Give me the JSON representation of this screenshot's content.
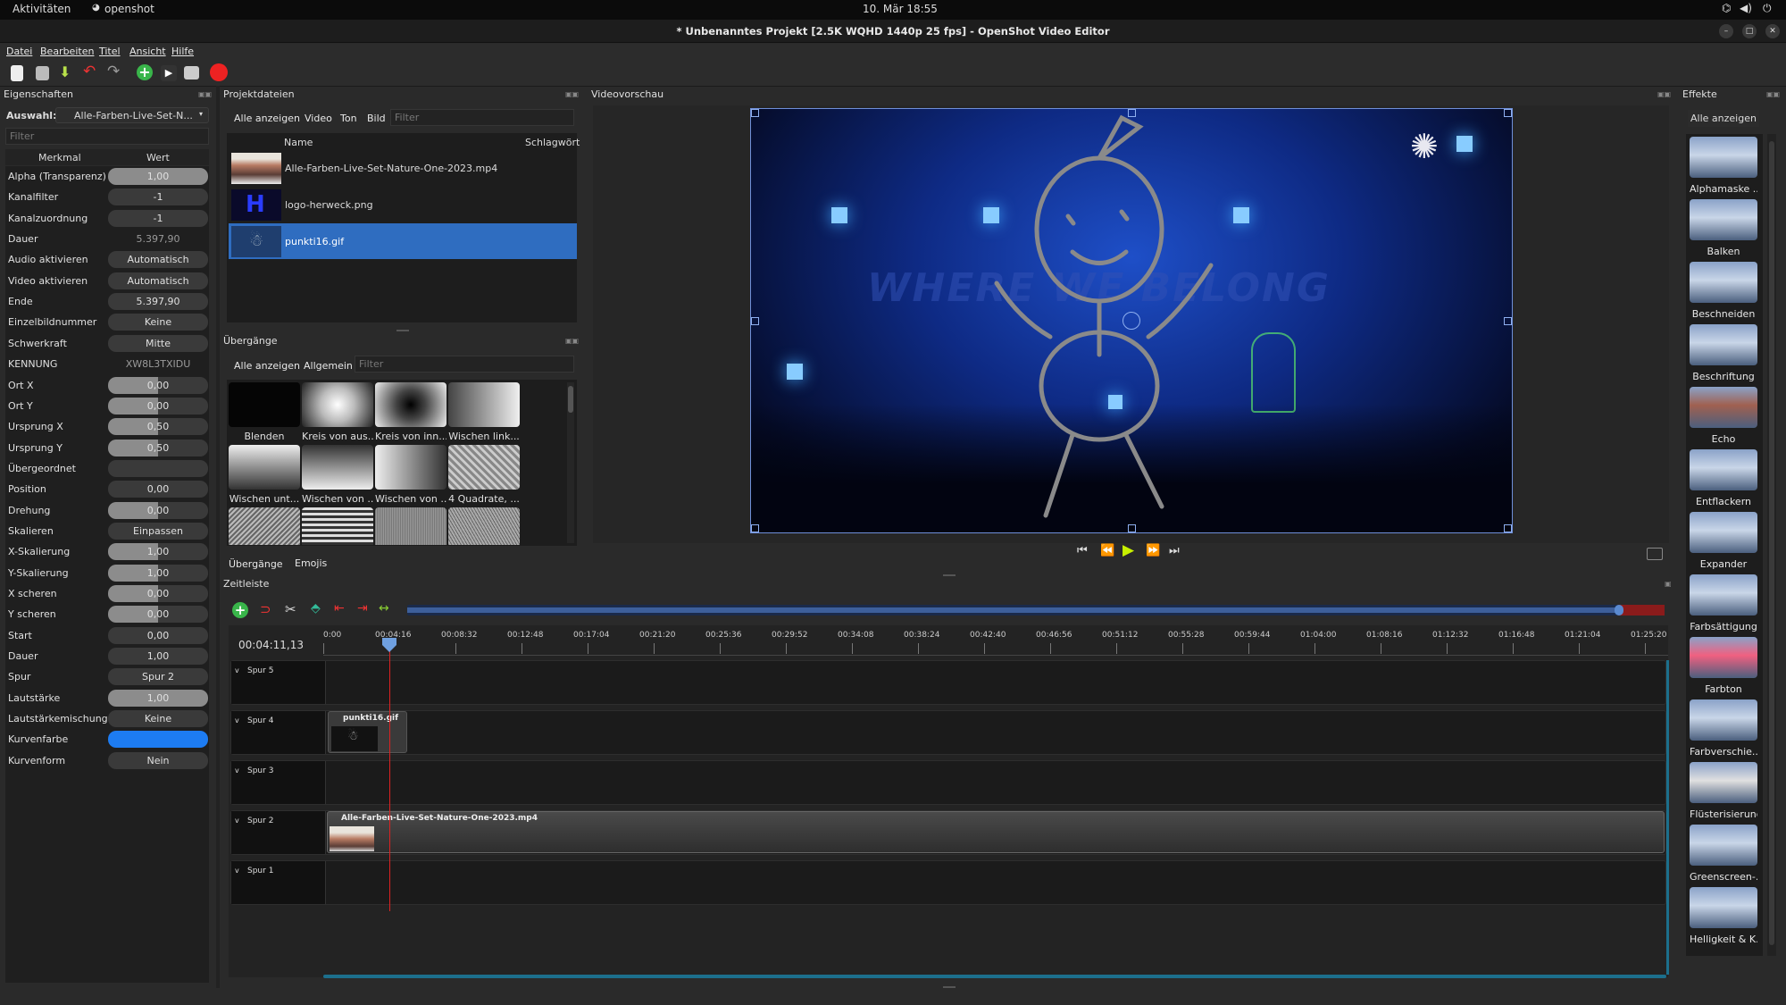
{
  "system": {
    "activities": "Aktivitäten",
    "app": "openshot",
    "clock": "10. Mär  18:55"
  },
  "window": {
    "title": "* Unbenanntes Projekt [2.5K WQHD 1440p 25 fps] - OpenShot Video Editor"
  },
  "menu": [
    "Datei",
    "Bearbeiten",
    "Titel",
    "Ansicht",
    "Hilfe"
  ],
  "properties": {
    "header": "Eigenschaften",
    "selection_label": "Auswahl:",
    "selection_value": "Alle-Farben-Live-Set-N...",
    "filter_placeholder": "Filter",
    "col_key": "Merkmal",
    "col_value": "Wert",
    "rows": [
      {
        "k": "Alpha (Transparenz)",
        "v": "1,00",
        "style": "bar"
      },
      {
        "k": "Kanalfilter",
        "v": "-1",
        "style": "dark"
      },
      {
        "k": "Kanalzuordnung",
        "v": "-1",
        "style": "dark"
      },
      {
        "k": "Dauer",
        "v": "5.397,90",
        "style": "none"
      },
      {
        "k": "Audio aktivieren",
        "v": "Automatisch",
        "style": "dark"
      },
      {
        "k": "Video aktivieren",
        "v": "Automatisch",
        "style": "dark"
      },
      {
        "k": "Ende",
        "v": "5.397,90",
        "style": "dark"
      },
      {
        "k": "Einzelbildnummer",
        "v": "Keine",
        "style": "dark"
      },
      {
        "k": "Schwerkraft",
        "v": "Mitte",
        "style": "dark"
      },
      {
        "k": "KENNUNG",
        "v": "XW8L3TXIDU",
        "style": "none"
      },
      {
        "k": "Ort X",
        "v": "0,00",
        "style": "half"
      },
      {
        "k": "Ort Y",
        "v": "0,00",
        "style": "half"
      },
      {
        "k": "Ursprung X",
        "v": "0,50",
        "style": "half"
      },
      {
        "k": "Ursprung Y",
        "v": "0,50",
        "style": "half"
      },
      {
        "k": "Übergeordnet",
        "v": "",
        "style": "dark"
      },
      {
        "k": "Position",
        "v": "0,00",
        "style": "dark"
      },
      {
        "k": "Drehung",
        "v": "0,00",
        "style": "half"
      },
      {
        "k": "Skalieren",
        "v": "Einpassen",
        "style": "dark"
      },
      {
        "k": "X-Skalierung",
        "v": "1,00",
        "style": "half"
      },
      {
        "k": "Y-Skalierung",
        "v": "1,00",
        "style": "half"
      },
      {
        "k": "X scheren",
        "v": "0,00",
        "style": "half"
      },
      {
        "k": "Y scheren",
        "v": "0,00",
        "style": "half"
      },
      {
        "k": "Start",
        "v": "0,00",
        "style": "dark"
      },
      {
        "k": "Dauer",
        "v": "1,00",
        "style": "dark"
      },
      {
        "k": "Spur",
        "v": "Spur 2",
        "style": "dark"
      },
      {
        "k": "Lautstärke",
        "v": "1,00",
        "style": "bar"
      },
      {
        "k": "Lautstärkemischung",
        "v": "Keine",
        "style": "dark"
      },
      {
        "k": "Kurvenfarbe",
        "v": "",
        "style": "blue"
      },
      {
        "k": "Kurvenform",
        "v": "Nein",
        "style": "dark"
      }
    ]
  },
  "project_files": {
    "header": "Projektdateien",
    "tabs": [
      "Alle anzeigen",
      "Video",
      "Ton",
      "Bild"
    ],
    "filter_placeholder": "Filter",
    "col_name": "Name",
    "col_tags": "Schlagwört",
    "files": [
      {
        "name": "Alle-Farben-Live-Set-Nature-One-2023.mp4",
        "selected": false
      },
      {
        "name": "logo-herweck.png",
        "selected": false
      },
      {
        "name": "punkti16.gif",
        "selected": true
      }
    ]
  },
  "transitions": {
    "header": "Übergänge",
    "tabs": [
      "Alle anzeigen",
      "Allgemein"
    ],
    "filter_placeholder": "Filter",
    "items": [
      "Blenden",
      "Kreis von aus...",
      "Kreis von inn...",
      "Wischen link...",
      "Wischen unt...",
      "Wischen von ...",
      "Wischen von ...",
      "4 Quadrate, ..."
    ],
    "bottom_tabs": [
      "Übergänge",
      "Emojis"
    ]
  },
  "preview": {
    "header": "Videovorschau",
    "overlay_text": "WHERE WE BELONG"
  },
  "effects": {
    "header": "Effekte",
    "show_all": "Alle anzeigen",
    "items": [
      "Alphamaske ...",
      "Balken",
      "Beschneiden",
      "Beschriftung",
      "Echo",
      "Entflackern",
      "Expander",
      "Farbsättigung",
      "Farbton",
      "Farbverschie...",
      "Flüsterisierung",
      "Greenscreen-...",
      "Helligkeit & K..."
    ]
  },
  "timeline": {
    "header": "Zeitleiste",
    "timecode": "00:04:11,13",
    "ruler": [
      "0:00",
      "00:04:16",
      "00:08:32",
      "00:12:48",
      "00:17:04",
      "00:21:20",
      "00:25:36",
      "00:29:52",
      "00:34:08",
      "00:38:24",
      "00:42:40",
      "00:46:56",
      "00:51:12",
      "00:55:28",
      "00:59:44",
      "01:04:00",
      "01:08:16",
      "01:12:32",
      "01:16:48",
      "01:21:04",
      "01:25:20"
    ],
    "tracks": [
      "Spur 5",
      "Spur 4",
      "Spur 3",
      "Spur 2",
      "Spur 1"
    ],
    "clip_gif": "punkti16.gif",
    "clip_video": "Alle-Farben-Live-Set-Nature-One-2023.mp4"
  }
}
